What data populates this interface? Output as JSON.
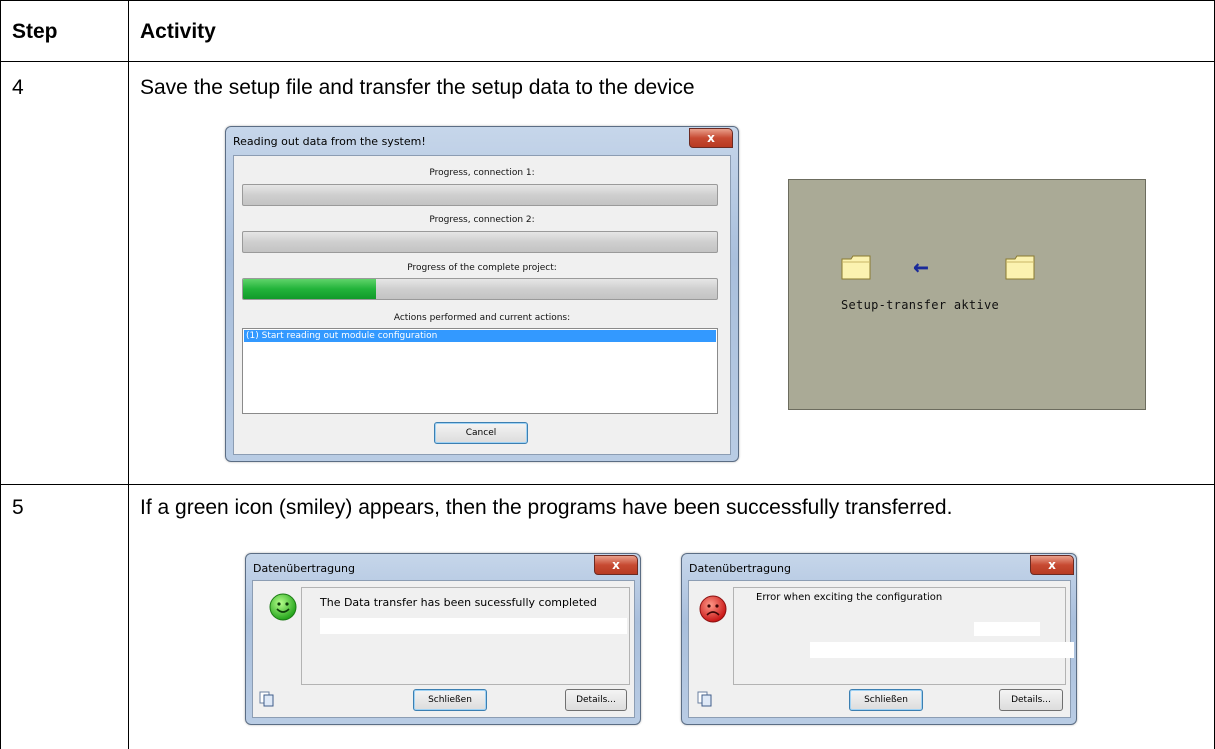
{
  "table": {
    "header_step": "Step",
    "header_activity": "Activity",
    "row4_step": "4",
    "row4_activity": "Save the setup file and transfer the setup data to the device",
    "row5_step": "5",
    "row5_activity": "If a green icon (smiley) appears, then the programs have been successfully transferred."
  },
  "progress_window": {
    "title": "Reading out data from the system!",
    "close_glyph": "x",
    "label_conn1": "Progress, connection 1:",
    "label_conn2": "Progress, connection 2:",
    "label_project": "Progress of the complete project:",
    "progress_conn1": 0,
    "progress_conn2": 0,
    "progress_project": 0.28,
    "label_actions": "Actions performed and current actions:",
    "action_current": "(1) Start reading out module configuration",
    "cancel_label": "Cancel"
  },
  "device_screen": {
    "status_text": "Setup-transfer aktive",
    "arrow_glyph": "←"
  },
  "success_dialog": {
    "title": "Datenübertragung",
    "close_glyph": "x",
    "message": "The Data transfer has been sucessfully completed",
    "close_button": "Schließen",
    "details_button": "Details..."
  },
  "error_dialog": {
    "title": "Datenübertragung",
    "close_glyph": "x",
    "message": "Error when exciting the configuration",
    "close_button": "Schließen",
    "details_button": "Details..."
  },
  "colors": {
    "progress_green": "#22b33a",
    "selection_blue": "#3399ff",
    "device_bg": "#aaaa96",
    "smiley_green": "#33cc22",
    "smiley_red": "#dd2222"
  }
}
